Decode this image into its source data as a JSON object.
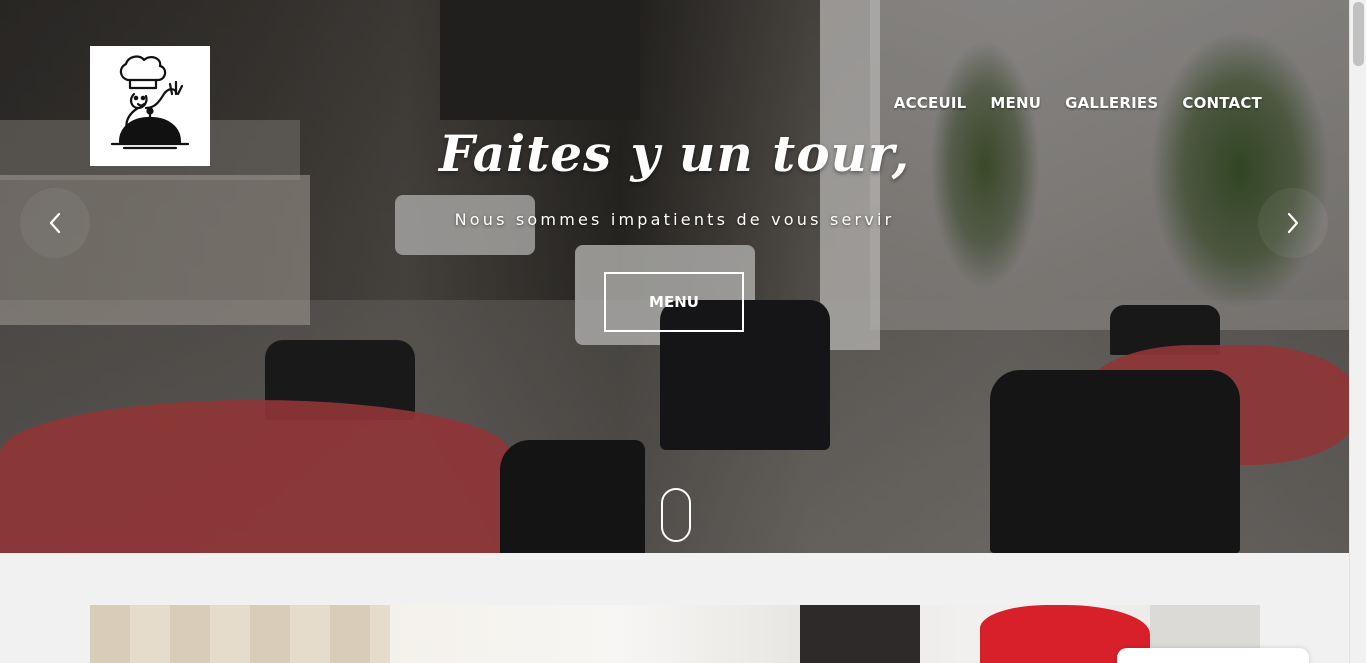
{
  "logo": {
    "icon": "chef-logo-icon"
  },
  "nav": {
    "items": [
      {
        "label": "ACCEUIL"
      },
      {
        "label": "MENU"
      },
      {
        "label": "GALLERIES"
      },
      {
        "label": "CONTACT"
      }
    ]
  },
  "hero": {
    "title": "Faites y un tour,",
    "subtitle": "Nous sommes impatients de vous servir",
    "button_label": "MENU",
    "prev_icon": "chevron-left-icon",
    "next_icon": "chevron-right-icon",
    "scroll_icon": "mouse-scroll-icon"
  },
  "colors": {
    "accent_red": "#b94446",
    "text_white": "#ffffff",
    "page_background": "#f1f1f1"
  }
}
